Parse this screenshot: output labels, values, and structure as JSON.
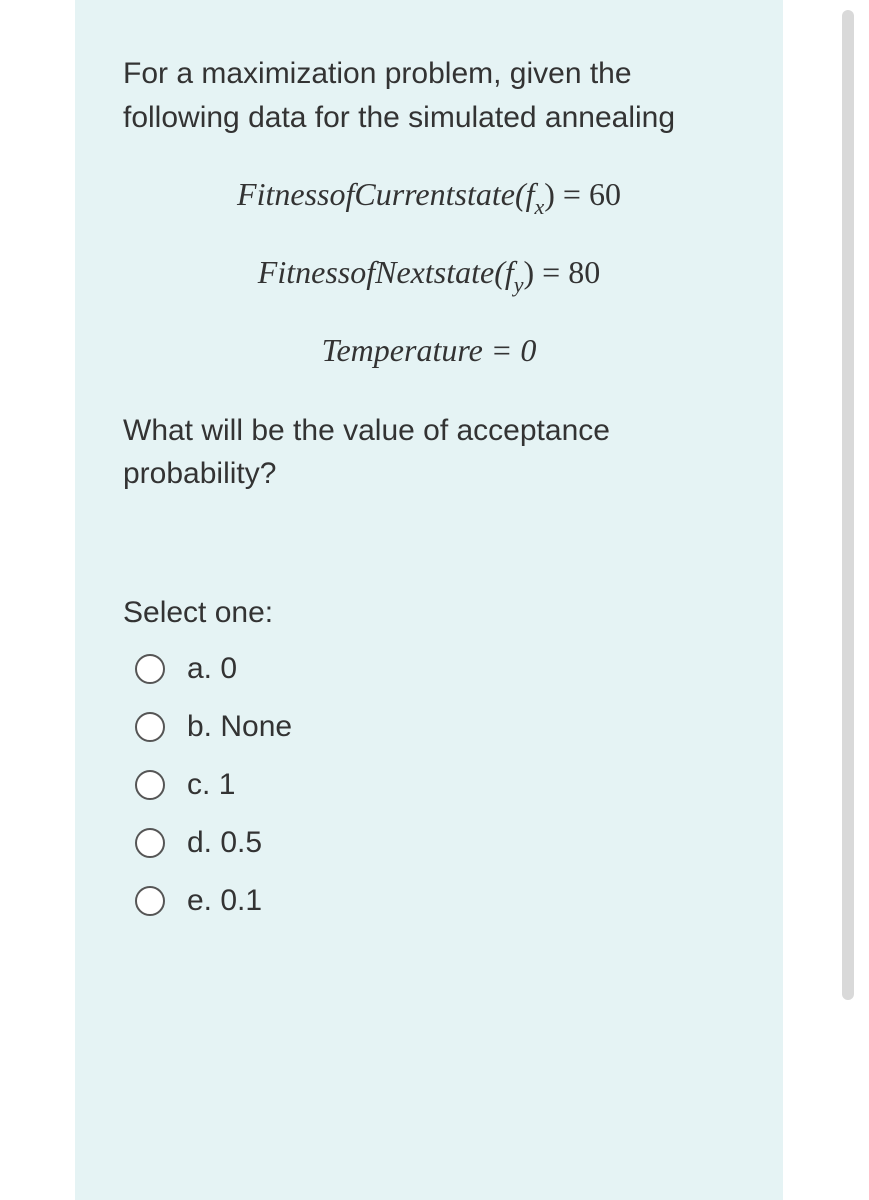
{
  "question": {
    "prompt1": "For a maximization problem, given the following data for the simulated annealing",
    "eq1_left": "FitnessofCurrentstate(f",
    "eq1_sub": "x",
    "eq1_right": ") = 60",
    "eq2_left": "FitnessofNextstate(f",
    "eq2_sub": "y",
    "eq2_right": ") = 80",
    "eq3": "Temperature = 0",
    "prompt2": "What will be the value of acceptance probability?",
    "select_label": "Select one:",
    "options": [
      {
        "letter": "a.",
        "text": "0"
      },
      {
        "letter": "b.",
        "text": "None"
      },
      {
        "letter": "c.",
        "text": "1"
      },
      {
        "letter": "d.",
        "text": "0.5"
      },
      {
        "letter": "e.",
        "text": "0.1"
      }
    ]
  }
}
